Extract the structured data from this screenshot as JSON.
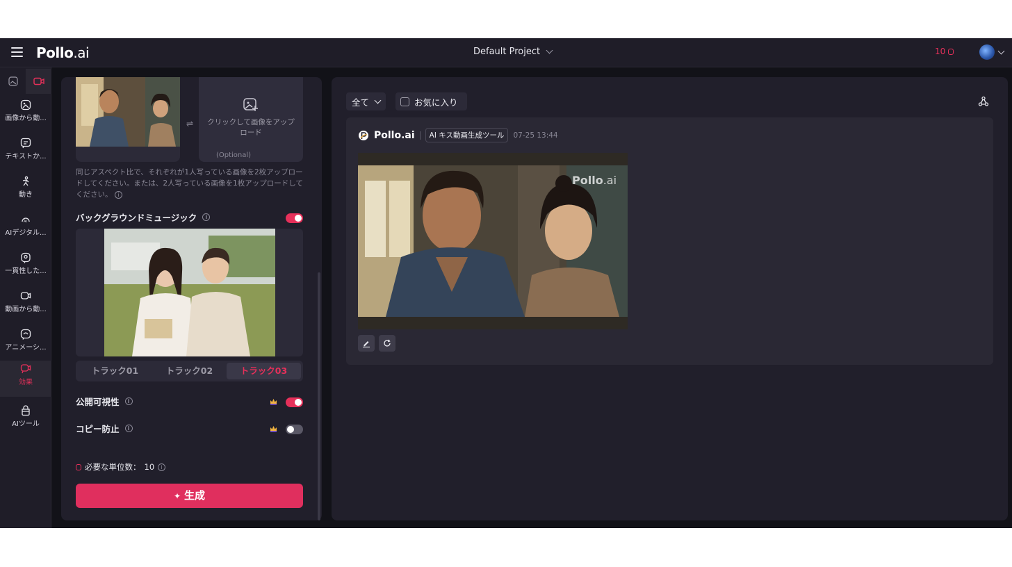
{
  "header": {
    "brand": "Pollo",
    "brand_suffix": ".ai",
    "project": "Default Project",
    "credits": "10"
  },
  "sidebar": {
    "items": [
      {
        "label": "画像から動..."
      },
      {
        "label": "テキストか..."
      },
      {
        "label": "動き"
      },
      {
        "label": "AIデジタル..."
      },
      {
        "label": "一貫性した..."
      },
      {
        "label": "動画から動..."
      },
      {
        "label": "アニメーシ..."
      },
      {
        "label": "効果"
      },
      {
        "label": "AIツール"
      }
    ]
  },
  "panel": {
    "upload_text": "クリックして画像をアップロード",
    "optional": "(Optional)",
    "hint": "同じアスペクト比で、それぞれが1人写っている画像を2枚アップロードしてください。または、2人写っている画像を1枚アップロードしてください。",
    "bgm_label": "バックグラウンドミュージック",
    "tracks": [
      "トラック01",
      "トラック02",
      "トラック03"
    ],
    "public_label": "公開可視性",
    "copy_label": "コピー防止",
    "cost_label": "必要な単位数：",
    "cost_value": "10",
    "generate": "生成"
  },
  "results": {
    "filter": "全て",
    "favorites": "お気に入り",
    "brand": "Pollo.ai",
    "tool_tag": "AI キス動画生成ツール",
    "timestamp": "07-25 13:44",
    "watermark_brand": "Pollo",
    "watermark_suffix": ".ai"
  },
  "colors": {
    "accent": "#e6305a",
    "panel": "#211f2b",
    "background": "#121218"
  }
}
